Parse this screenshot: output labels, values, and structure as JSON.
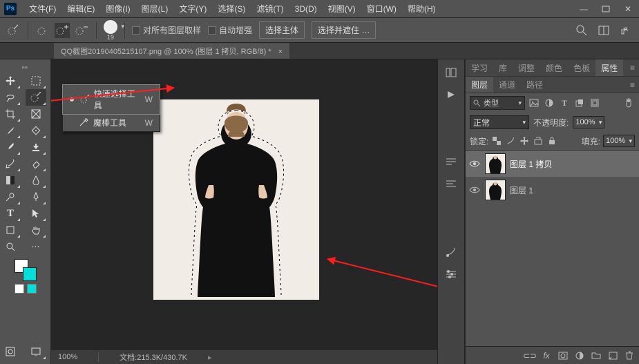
{
  "menu": {
    "items": [
      "文件(F)",
      "编辑(E)",
      "图像(I)",
      "图层(L)",
      "文字(Y)",
      "选择(S)",
      "滤镜(T)",
      "3D(D)",
      "视图(V)",
      "窗口(W)",
      "帮助(H)"
    ]
  },
  "optionsbar": {
    "brush_size": "19",
    "chk_sample_all": "对所有图层取样",
    "chk_auto_enhance": "自动增强",
    "btn_select_subject": "选择主体",
    "btn_select_and_mask": "选择并遮住 …"
  },
  "document": {
    "tab_title": "QQ截图20190405215107.png @ 100% (图层 1 拷贝, RGB/8) *"
  },
  "flyout": {
    "items": [
      {
        "label": "快速选择工具",
        "shortcut": "W",
        "active": true
      },
      {
        "label": "魔棒工具",
        "shortcut": "W",
        "active": false
      }
    ]
  },
  "panels_right_top": {
    "tabs": [
      "学习",
      "库",
      "调整",
      "颜色",
      "色板",
      "属性"
    ],
    "active": 5
  },
  "layers_panel": {
    "tabs": [
      "图层",
      "通道",
      "路径"
    ],
    "active": 0,
    "filter_label": "类型",
    "blend_mode": "正常",
    "opacity_label": "不透明度:",
    "opacity_value": "100%",
    "lock_label": "锁定:",
    "fill_label": "填充:",
    "fill_value": "100%",
    "layers": [
      {
        "name": "图层 1 拷贝",
        "visible": true,
        "selected": true
      },
      {
        "name": "图层 1",
        "visible": true,
        "selected": false
      }
    ]
  },
  "statusbar": {
    "zoom": "100%",
    "doc_info": "文档:215.3K/430.7K"
  },
  "tool_names": [
    "move",
    "artboard",
    "marquee",
    "lasso",
    "quick-select",
    "magic-wand",
    "crop",
    "frame",
    "eyedropper",
    "ruler",
    "healing",
    "brush",
    "clone",
    "history",
    "eraser",
    "gradient",
    "blur",
    "dodge",
    "pen",
    "type",
    "path-sel",
    "shape",
    "hand",
    "zoom",
    "edit-toolbar",
    "ellipsis"
  ]
}
